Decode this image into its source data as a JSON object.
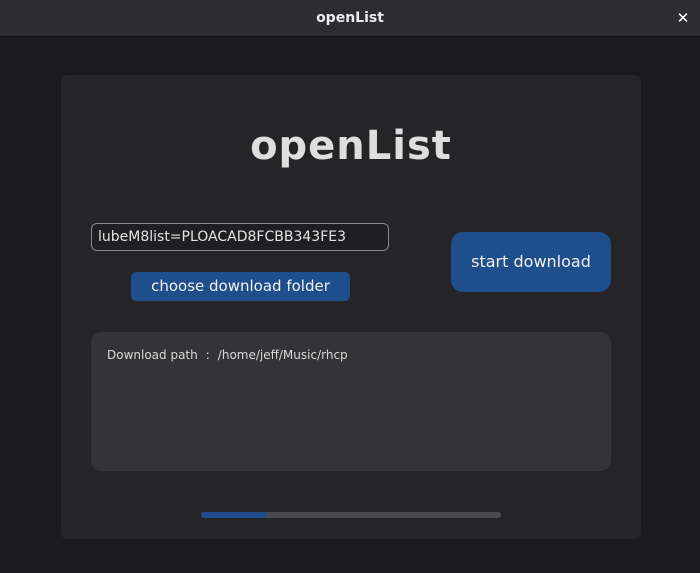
{
  "window": {
    "title": "openList",
    "close_glyph": "✕"
  },
  "app": {
    "logo_text": "openList"
  },
  "form": {
    "url_value": "lubeM8list=PLOACAD8FCBB343FE3",
    "choose_folder_label": "choose download folder",
    "start_label": "start download"
  },
  "output": {
    "path_label": "Download path",
    "path_separator": ":",
    "path_value": "/home/jeff/Music/rhcp"
  },
  "progress": {
    "fraction": 0.22
  },
  "colors": {
    "accent": "#1e4e8c",
    "background": "#1b1a1d",
    "panel": "#252427"
  }
}
